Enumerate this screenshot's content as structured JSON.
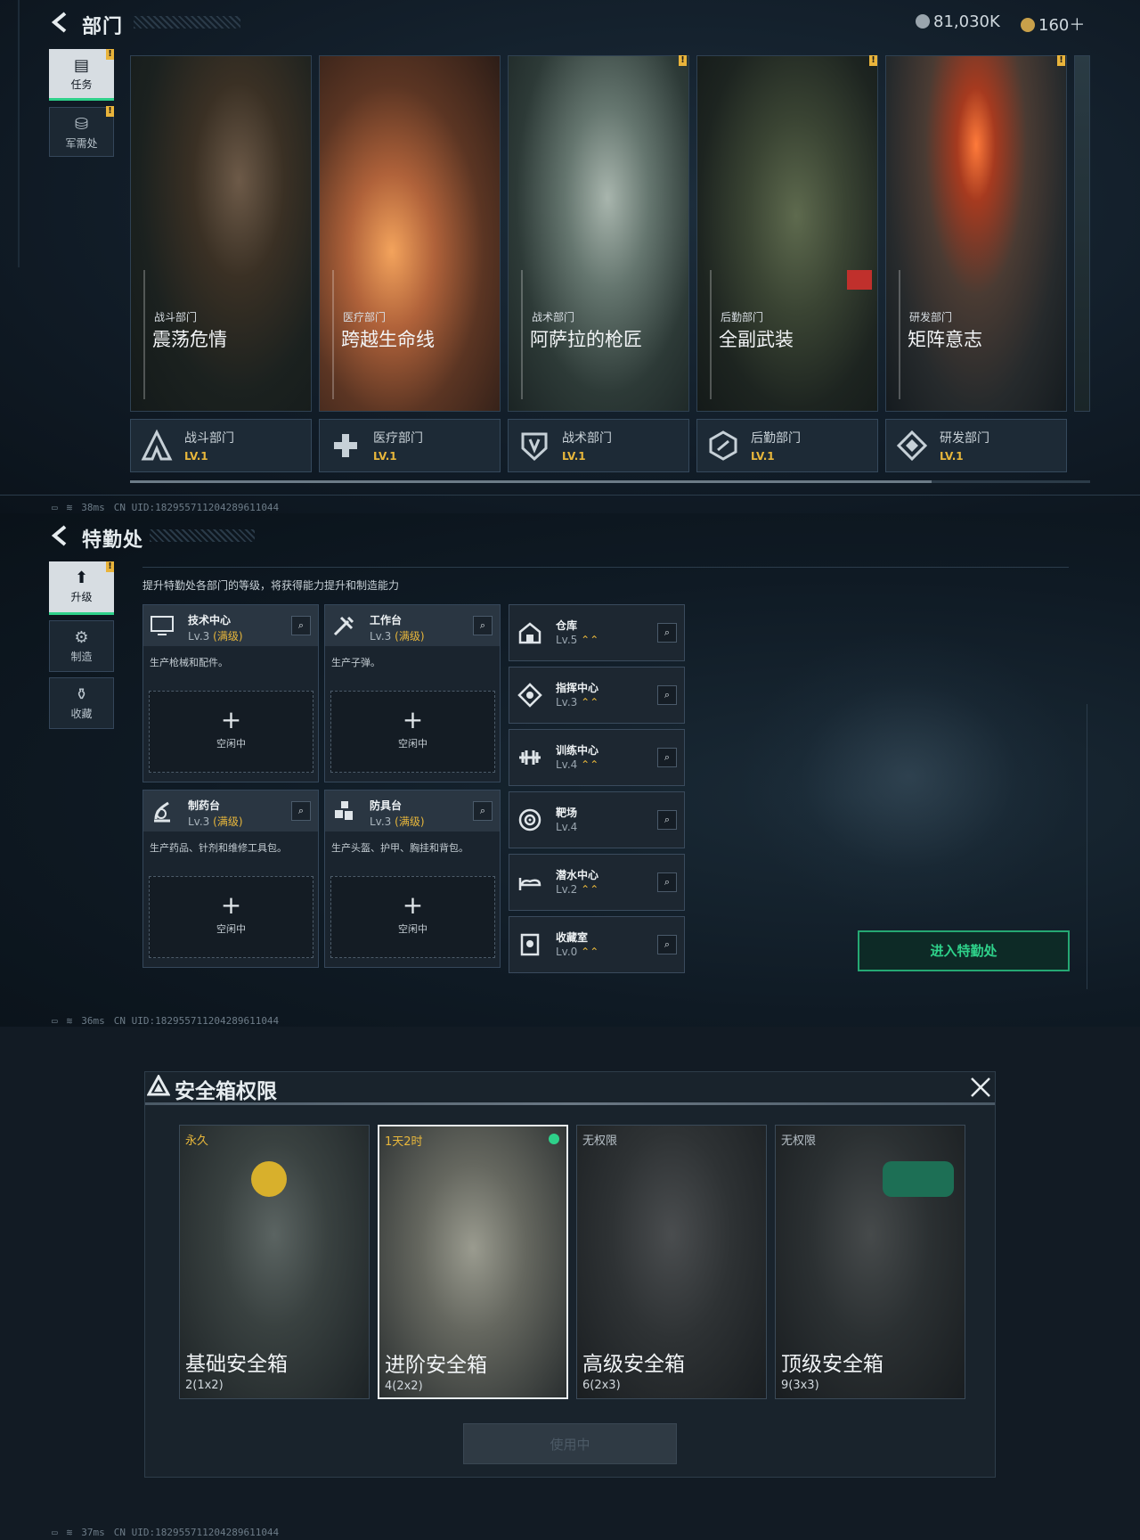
{
  "colors": {
    "accent_green": "#2ed18a",
    "gold": "#e8b73b",
    "panel": "#1d2a36"
  },
  "screen1": {
    "title": "部门",
    "currency_silver": "81,030K",
    "currency_gold": "160＋",
    "tabs": [
      {
        "label": "任务",
        "icon": "task-icon"
      },
      {
        "label": "军需处",
        "icon": "supply-icon"
      }
    ],
    "cards": [
      {
        "category": "战斗部门",
        "name": "震荡危情",
        "footer": "战斗部门",
        "level": "LV.1"
      },
      {
        "category": "医疗部门",
        "name": "跨越生命线",
        "footer": "医疗部门",
        "level": "LV.1"
      },
      {
        "category": "战术部门",
        "name": "阿萨拉的枪匠",
        "footer": "战术部门",
        "level": "LV.1"
      },
      {
        "category": "后勤部门",
        "name": "全副武装",
        "footer": "后勤部门",
        "level": "LV.1"
      },
      {
        "category": "研发部门",
        "name": "矩阵意志",
        "footer": "研发部门",
        "level": "LV.1"
      }
    ],
    "status": {
      "ping": "38ms",
      "uid": "CN UID:18295571120428961104​4"
    }
  },
  "screen2": {
    "title": "特勤处",
    "tabs": [
      {
        "label": "升级",
        "icon": "upgrade-icon"
      },
      {
        "label": "制造",
        "icon": "craft-icon"
      },
      {
        "label": "收藏",
        "icon": "collection-icon"
      }
    ],
    "description": "提升特勤处各部门的等级，将获得能力提升和制造能力",
    "facilities": [
      {
        "name": "技术中心",
        "level": "Lv.3",
        "max": "(满级)",
        "desc": "生产枪械和配件。",
        "slot": "空闲中"
      },
      {
        "name": "工作台",
        "level": "Lv.3",
        "max": "(满级)",
        "desc": "生产子弹。",
        "slot": "空闲中"
      },
      {
        "name": "制药台",
        "level": "Lv.3",
        "max": "(满级)",
        "desc": "生产药品、针剂和维修工具包。",
        "slot": "空闲中"
      },
      {
        "name": "防具台",
        "level": "Lv.3",
        "max": "(满级)",
        "desc": "生产头盔、护甲、胸挂和背包。",
        "slot": "空闲中"
      }
    ],
    "rooms": [
      {
        "name": "仓库",
        "level": "Lv.5",
        "up": "⌃⌃"
      },
      {
        "name": "指挥中心",
        "level": "Lv.3",
        "up": "⌃⌃"
      },
      {
        "name": "训练中心",
        "level": "Lv.4",
        "up": "⌃⌃"
      },
      {
        "name": "靶场",
        "level": "Lv.4",
        "up": ""
      },
      {
        "name": "潜水中心",
        "level": "Lv.2",
        "up": "⌃⌃"
      },
      {
        "name": "收藏室",
        "level": "Lv.0",
        "up": "⌃⌃"
      }
    ],
    "enter_button": "进入特勤处",
    "status": {
      "ping": "36ms",
      "uid": "CN UID:18295571120428961104​4"
    }
  },
  "screen3": {
    "title": "安全箱权限",
    "boxes": [
      {
        "tag": "永久",
        "name": "基础安全箱",
        "size": "2(1x2)",
        "tag_color": "#e8b73b"
      },
      {
        "tag": "1天2时",
        "name": "进阶安全箱",
        "size": "4(2x2)",
        "tag_color": "#e8b73b"
      },
      {
        "tag": "无权限",
        "name": "高级安全箱",
        "size": "6(2x3)",
        "tag_color": "#b7c0c7"
      },
      {
        "tag": "无权限",
        "name": "顶级安全箱",
        "size": "9(3x3)",
        "tag_color": "#b7c0c7"
      }
    ],
    "use_button": "使用中",
    "status": {
      "ping": "37ms",
      "uid": "CN UID:18295571120428961104​4"
    }
  }
}
